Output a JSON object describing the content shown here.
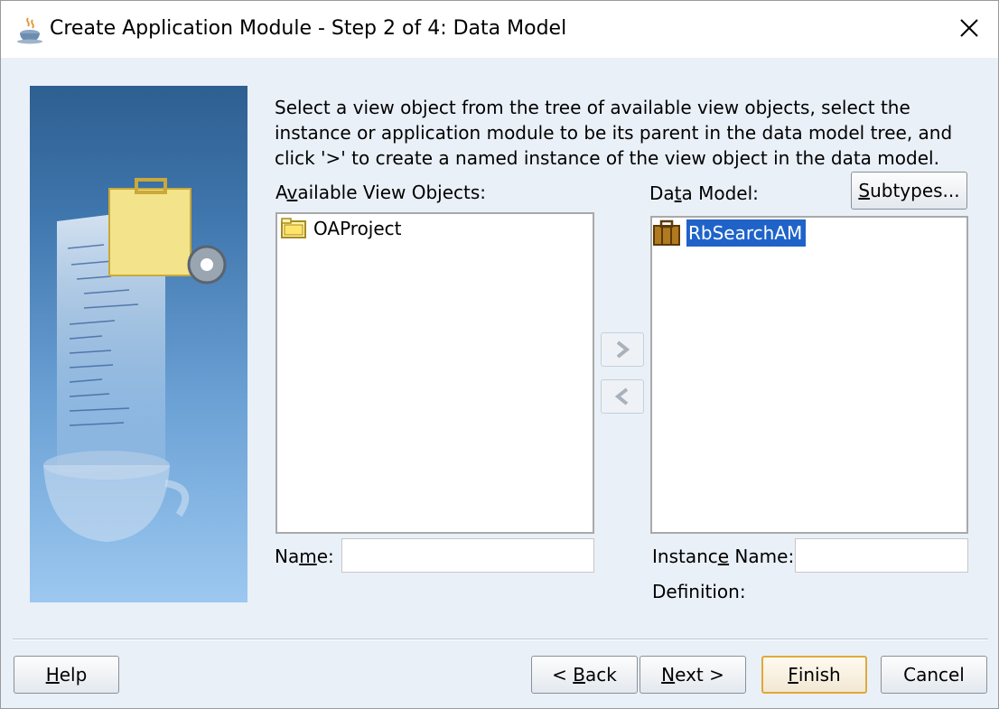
{
  "window": {
    "title": "Create Application Module - Step 2 of 4: Data Model"
  },
  "instructions": "Select a view object from the tree of available view objects, select the instance or application module to be its parent in the data model tree, and click '>' to create a named instance of the view object in the data model.",
  "available": {
    "label_pre": "A",
    "label_mn": "v",
    "label_post": "ailable View Objects:",
    "items": [
      {
        "label": "OAProject",
        "icon": "folder-icon"
      }
    ]
  },
  "data_model": {
    "label_pre": "Da",
    "label_mn": "t",
    "label_post": "a Model:",
    "subtypes_pre": "",
    "subtypes_mn": "S",
    "subtypes_post": "ubtypes...",
    "items": [
      {
        "label": "RbSearchAM",
        "icon": "briefcase-icon",
        "selected": true
      }
    ]
  },
  "shuttle": {
    "add_icon": "chevron-right-icon",
    "remove_icon": "chevron-left-icon"
  },
  "name_field": {
    "label_pre": "Na",
    "label_mn": "m",
    "label_post": "e:",
    "value": ""
  },
  "instance_name": {
    "label_pre": "Instanc",
    "label_mn": "e",
    "label_post": " Name:",
    "value": ""
  },
  "definition": {
    "label": "Definition:",
    "value": ""
  },
  "buttons": {
    "help": {
      "pre": "",
      "mn": "H",
      "post": "elp"
    },
    "back": {
      "pre": "< ",
      "mn": "B",
      "post": "ack"
    },
    "next": {
      "pre": "",
      "mn": "N",
      "post": "ext >"
    },
    "finish": {
      "pre": "",
      "mn": "F",
      "post": "inish"
    },
    "cancel": {
      "pre": "",
      "mn": "",
      "post": "Cancel"
    }
  },
  "colors": {
    "selection": "#1f63c9",
    "accent_border": "#e0a93a",
    "dialog_bg": "#eaf0f8"
  }
}
